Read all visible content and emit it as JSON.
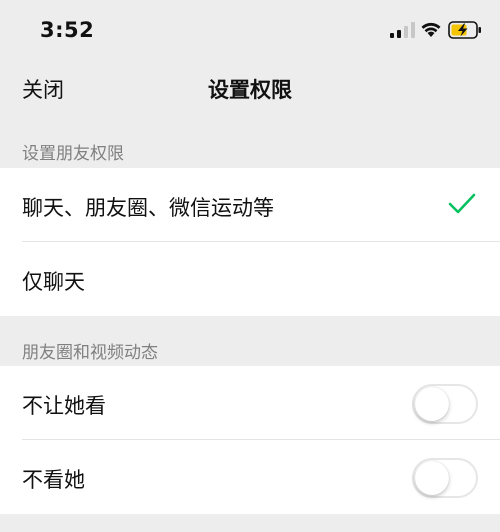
{
  "status_bar": {
    "time": "3:52",
    "icons": [
      "cellular-signal-icon",
      "wifi-icon",
      "battery-charging-icon"
    ]
  },
  "nav": {
    "close_label": "关闭",
    "title": "设置权限"
  },
  "section1": {
    "header": "设置朋友权限",
    "options": [
      {
        "label": "聊天、朋友圈、微信运动等",
        "selected": true
      },
      {
        "label": "仅聊天",
        "selected": false
      }
    ]
  },
  "section2": {
    "header": "朋友圈和视频动态",
    "toggles": [
      {
        "label": "不让她看",
        "on": false
      },
      {
        "label": "不看她",
        "on": false
      }
    ]
  },
  "colors": {
    "background": "#ededed",
    "check_green": "#07c160",
    "battery_yellow": "#f5c400",
    "section_header_gray": "#808080"
  }
}
